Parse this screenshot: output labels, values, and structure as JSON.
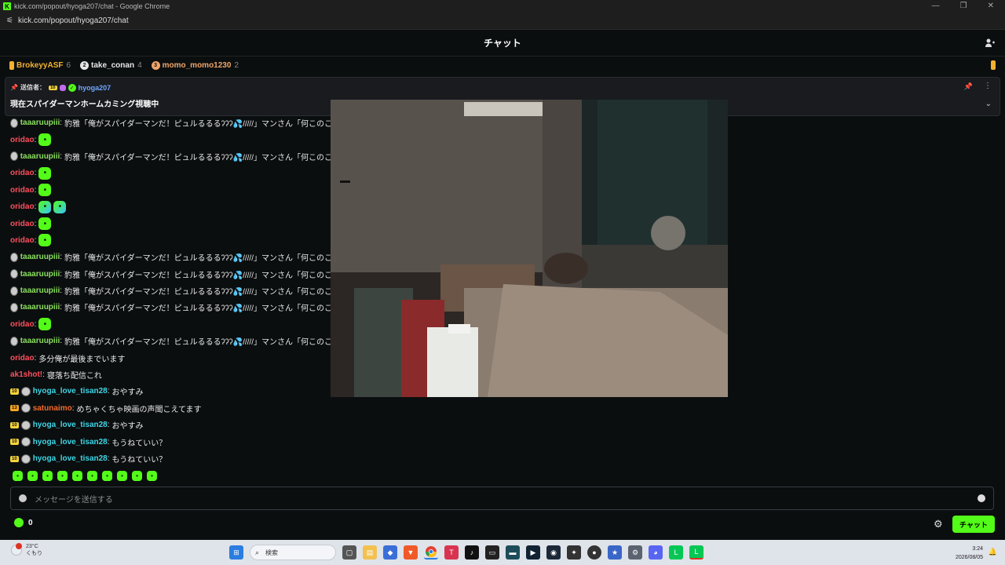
{
  "window": {
    "title": "kick.com/popout/hyoga207/chat - Google Chrome",
    "url": "kick.com/popout/hyoga207/chat"
  },
  "header": {
    "title": "チャット"
  },
  "gifters": [
    {
      "rank": "",
      "name": "BrokeyyASF",
      "count": "6",
      "color": "#f2b230"
    },
    {
      "rank": "2",
      "name": "take_conan",
      "count": "4",
      "color": "#e6e6e6"
    },
    {
      "rank": "3",
      "name": "momo_momo1230",
      "count": "2",
      "color": "#f0a56a"
    }
  ],
  "pinned": {
    "label": "送信者：",
    "badge": "10",
    "host": "hyoga207",
    "message": "現在スパイダーマンホームカミング視聴中"
  },
  "messages": [
    {
      "user": "taaaruupiii",
      "color": "green",
      "avatar": true,
      "text": "豹雅「俺がスパイダーマンだ！ピュルるるるʔʔʔ💦/////」マンさん「何このこの"
    },
    {
      "user": "oridao",
      "color": "red",
      "emotes": 1
    },
    {
      "user": "taaaruupiii",
      "color": "green",
      "avatar": true,
      "text": "豹雅「俺がスパイダーマンだ！ピュルるるるʔʔʔ💦/////」マンさん「何このこの"
    },
    {
      "user": "oridao",
      "color": "red",
      "emotes": 1
    },
    {
      "user": "oridao",
      "color": "red",
      "emotes": 1
    },
    {
      "user": "oridao",
      "color": "red",
      "emotes": 2
    },
    {
      "user": "oridao",
      "color": "red",
      "emotes": 1
    },
    {
      "user": "oridao",
      "color": "red",
      "emotes": 1
    },
    {
      "user": "taaaruupiii",
      "color": "green",
      "avatar": true,
      "text": "豹雅「俺がスパイダーマンだ！ピュルるるるʔʔʔ💦/////」マンさん「何このこの"
    },
    {
      "user": "taaaruupiii",
      "color": "green",
      "avatar": true,
      "text": "豹雅「俺がスパイダーマンだ！ピュルるるるʔʔʔ💦/////」マンさん「何このこの"
    },
    {
      "user": "taaaruupiii",
      "color": "green",
      "avatar": true,
      "text": "豹雅「俺がスパイダーマンだ！ピュルるるるʔʔʔ💦/////」マンさん「何このこの"
    },
    {
      "user": "taaaruupiii",
      "color": "green",
      "avatar": true,
      "text": "豹雅「俺がスパイダーマンだ！ピュルるるるʔʔʔ💦/////」マンさん「何このこの"
    },
    {
      "user": "oridao",
      "color": "red",
      "emotes": 1
    },
    {
      "user": "taaaruupiii",
      "color": "green",
      "avatar": true,
      "text": "豹雅「俺がスパイダーマンだ！ピュルるるるʔʔʔ💦/////」マンさん「何このこの"
    },
    {
      "user": "oridao",
      "color": "red",
      "text": "多分俺が最後までいます"
    },
    {
      "user": "ak1shot!",
      "color": "red",
      "text": "寝落ち配信これ"
    },
    {
      "user": "hyoga_love_tisan28",
      "color": "cyan",
      "badge": "10",
      "avatar": true,
      "text": "おやすみ"
    },
    {
      "user": "satunaimo",
      "color": "orange",
      "badge": "13",
      "avatar": true,
      "text": "めちゃくちゃ映画の声聞こえてます"
    },
    {
      "user": "hyoga_love_tisan28",
      "color": "cyan",
      "badge": "10",
      "avatar": true,
      "text": "おやすみ"
    },
    {
      "user": "hyoga_love_tisan28",
      "color": "cyan",
      "badge": "10",
      "avatar": true,
      "text": "もうねていい？"
    },
    {
      "user": "hyoga_love_tisan28",
      "color": "cyan",
      "badge": "10",
      "avatar": true,
      "text": "もうねていい？"
    }
  ],
  "composer": {
    "placeholder": "メッセージを送信する"
  },
  "footer": {
    "points": "0",
    "send_label": "チャット"
  },
  "taskbar": {
    "weather_temp": "23°C",
    "weather_desc": "くもり",
    "search_placeholder": "検索",
    "time": "3:24",
    "date": "2026/08/05"
  }
}
